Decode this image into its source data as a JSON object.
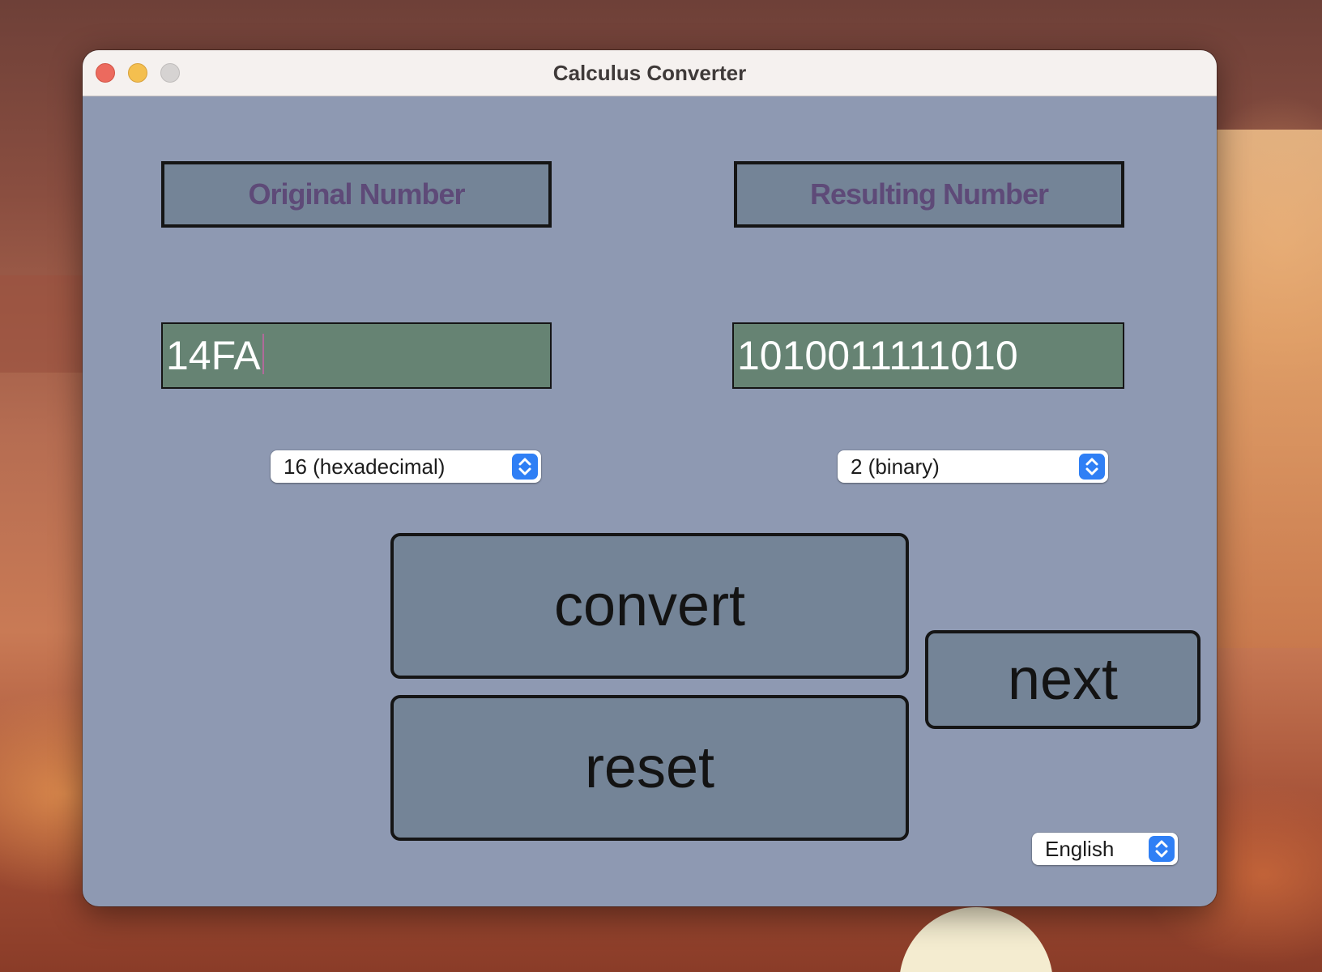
{
  "window": {
    "title": "Calculus Converter"
  },
  "labels": {
    "original": "Original Number",
    "resulting": "Resulting Number"
  },
  "inputs": {
    "original_value": "14FA",
    "result_value": "1010011111010"
  },
  "selects": {
    "from_base": "16 (hexadecimal)",
    "to_base": "2 (binary)",
    "language": "English"
  },
  "buttons": {
    "convert": "convert",
    "reset": "reset",
    "next": "next"
  },
  "colors": {
    "window_bg": "#8e99b2",
    "header_box": "#748497",
    "header_text": "#5e4a78",
    "field_bg": "#668373",
    "button_bg": "#748497",
    "select_chevron": "#2f7ff5"
  }
}
